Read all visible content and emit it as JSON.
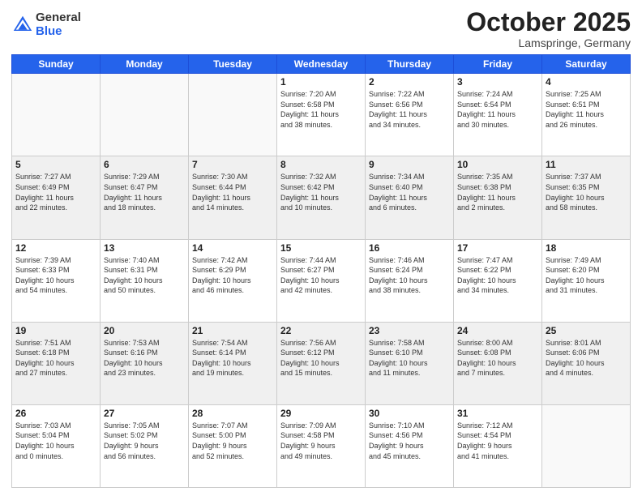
{
  "header": {
    "logo_general": "General",
    "logo_blue": "Blue",
    "title": "October 2025",
    "location": "Lamspringe, Germany"
  },
  "days_of_week": [
    "Sunday",
    "Monday",
    "Tuesday",
    "Wednesday",
    "Thursday",
    "Friday",
    "Saturday"
  ],
  "weeks": [
    [
      {
        "num": "",
        "info": ""
      },
      {
        "num": "",
        "info": ""
      },
      {
        "num": "",
        "info": ""
      },
      {
        "num": "1",
        "info": "Sunrise: 7:20 AM\nSunset: 6:58 PM\nDaylight: 11 hours\nand 38 minutes."
      },
      {
        "num": "2",
        "info": "Sunrise: 7:22 AM\nSunset: 6:56 PM\nDaylight: 11 hours\nand 34 minutes."
      },
      {
        "num": "3",
        "info": "Sunrise: 7:24 AM\nSunset: 6:54 PM\nDaylight: 11 hours\nand 30 minutes."
      },
      {
        "num": "4",
        "info": "Sunrise: 7:25 AM\nSunset: 6:51 PM\nDaylight: 11 hours\nand 26 minutes."
      }
    ],
    [
      {
        "num": "5",
        "info": "Sunrise: 7:27 AM\nSunset: 6:49 PM\nDaylight: 11 hours\nand 22 minutes."
      },
      {
        "num": "6",
        "info": "Sunrise: 7:29 AM\nSunset: 6:47 PM\nDaylight: 11 hours\nand 18 minutes."
      },
      {
        "num": "7",
        "info": "Sunrise: 7:30 AM\nSunset: 6:44 PM\nDaylight: 11 hours\nand 14 minutes."
      },
      {
        "num": "8",
        "info": "Sunrise: 7:32 AM\nSunset: 6:42 PM\nDaylight: 11 hours\nand 10 minutes."
      },
      {
        "num": "9",
        "info": "Sunrise: 7:34 AM\nSunset: 6:40 PM\nDaylight: 11 hours\nand 6 minutes."
      },
      {
        "num": "10",
        "info": "Sunrise: 7:35 AM\nSunset: 6:38 PM\nDaylight: 11 hours\nand 2 minutes."
      },
      {
        "num": "11",
        "info": "Sunrise: 7:37 AM\nSunset: 6:35 PM\nDaylight: 10 hours\nand 58 minutes."
      }
    ],
    [
      {
        "num": "12",
        "info": "Sunrise: 7:39 AM\nSunset: 6:33 PM\nDaylight: 10 hours\nand 54 minutes."
      },
      {
        "num": "13",
        "info": "Sunrise: 7:40 AM\nSunset: 6:31 PM\nDaylight: 10 hours\nand 50 minutes."
      },
      {
        "num": "14",
        "info": "Sunrise: 7:42 AM\nSunset: 6:29 PM\nDaylight: 10 hours\nand 46 minutes."
      },
      {
        "num": "15",
        "info": "Sunrise: 7:44 AM\nSunset: 6:27 PM\nDaylight: 10 hours\nand 42 minutes."
      },
      {
        "num": "16",
        "info": "Sunrise: 7:46 AM\nSunset: 6:24 PM\nDaylight: 10 hours\nand 38 minutes."
      },
      {
        "num": "17",
        "info": "Sunrise: 7:47 AM\nSunset: 6:22 PM\nDaylight: 10 hours\nand 34 minutes."
      },
      {
        "num": "18",
        "info": "Sunrise: 7:49 AM\nSunset: 6:20 PM\nDaylight: 10 hours\nand 31 minutes."
      }
    ],
    [
      {
        "num": "19",
        "info": "Sunrise: 7:51 AM\nSunset: 6:18 PM\nDaylight: 10 hours\nand 27 minutes."
      },
      {
        "num": "20",
        "info": "Sunrise: 7:53 AM\nSunset: 6:16 PM\nDaylight: 10 hours\nand 23 minutes."
      },
      {
        "num": "21",
        "info": "Sunrise: 7:54 AM\nSunset: 6:14 PM\nDaylight: 10 hours\nand 19 minutes."
      },
      {
        "num": "22",
        "info": "Sunrise: 7:56 AM\nSunset: 6:12 PM\nDaylight: 10 hours\nand 15 minutes."
      },
      {
        "num": "23",
        "info": "Sunrise: 7:58 AM\nSunset: 6:10 PM\nDaylight: 10 hours\nand 11 minutes."
      },
      {
        "num": "24",
        "info": "Sunrise: 8:00 AM\nSunset: 6:08 PM\nDaylight: 10 hours\nand 7 minutes."
      },
      {
        "num": "25",
        "info": "Sunrise: 8:01 AM\nSunset: 6:06 PM\nDaylight: 10 hours\nand 4 minutes."
      }
    ],
    [
      {
        "num": "26",
        "info": "Sunrise: 7:03 AM\nSunset: 5:04 PM\nDaylight: 10 hours\nand 0 minutes."
      },
      {
        "num": "27",
        "info": "Sunrise: 7:05 AM\nSunset: 5:02 PM\nDaylight: 9 hours\nand 56 minutes."
      },
      {
        "num": "28",
        "info": "Sunrise: 7:07 AM\nSunset: 5:00 PM\nDaylight: 9 hours\nand 52 minutes."
      },
      {
        "num": "29",
        "info": "Sunrise: 7:09 AM\nSunset: 4:58 PM\nDaylight: 9 hours\nand 49 minutes."
      },
      {
        "num": "30",
        "info": "Sunrise: 7:10 AM\nSunset: 4:56 PM\nDaylight: 9 hours\nand 45 minutes."
      },
      {
        "num": "31",
        "info": "Sunrise: 7:12 AM\nSunset: 4:54 PM\nDaylight: 9 hours\nand 41 minutes."
      },
      {
        "num": "",
        "info": ""
      }
    ]
  ]
}
